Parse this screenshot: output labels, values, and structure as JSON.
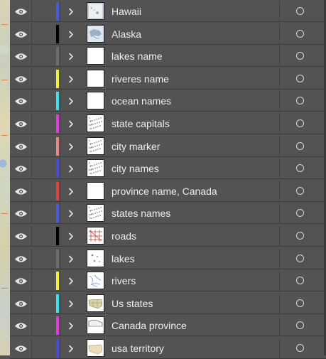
{
  "layers": [
    {
      "name": "Hawaii",
      "color": "#4a5ae0",
      "thumb": "hawaii"
    },
    {
      "name": "Alaska",
      "color": "#000000",
      "thumb": "alaska"
    },
    {
      "name": "lakes name",
      "color": "#6e6e6e",
      "thumb": "blank"
    },
    {
      "name": "riveres name",
      "color": "#f2f23a",
      "thumb": "blank"
    },
    {
      "name": "ocean names",
      "color": "#3ee2ee",
      "thumb": "blank"
    },
    {
      "name": "state capitals",
      "color": "#e23ae2",
      "thumb": "dots"
    },
    {
      "name": "city marker",
      "color": "#e88888",
      "thumb": "dots"
    },
    {
      "name": "city names",
      "color": "#4a4ad8",
      "thumb": "dots"
    },
    {
      "name": "province name, Canada",
      "color": "#e04040",
      "thumb": "blank"
    },
    {
      "name": "states names",
      "color": "#4a5ae0",
      "thumb": "dots"
    },
    {
      "name": "roads",
      "color": "#000000",
      "thumb": "roads"
    },
    {
      "name": "lakes",
      "color": "#6e6e6e",
      "thumb": "lakes"
    },
    {
      "name": "rivers",
      "color": "#f2f23a",
      "thumb": "rivers"
    },
    {
      "name": "Us states",
      "color": "#3ee2ee",
      "thumb": "usstates"
    },
    {
      "name": "Canada province",
      "color": "#e23ae2",
      "thumb": "canada"
    },
    {
      "name": "usa territory",
      "color": "#4a4ad8",
      "thumb": "territory"
    }
  ]
}
